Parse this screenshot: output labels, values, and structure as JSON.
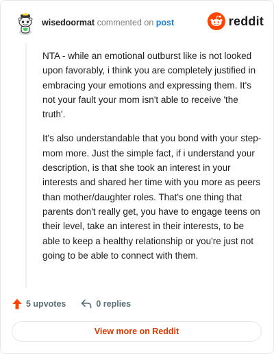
{
  "header": {
    "username": "wisedoormat",
    "action_text": "commented on",
    "link_text": "post",
    "brand": "reddit",
    "avatar_icon": "snoo-avatar-icon",
    "brand_icon": "reddit-logo-icon"
  },
  "comment": {
    "paragraphs": [
      "NTA - while an emotional outburst like is not looked upon favorably, i think you are completely justified in embracing your emotions and expressing them. It's not your fault your mom isn't able to receive 'the truth'.",
      "It's also understandable that you bond with your step-mom more. Just the simple fact, if i understand your description, is that she took an interest in your interests and shared her time with you more as peers than mother/daughter roles. That's one thing that parents don't really get, you have to engage teens on their level, take an interest in their interests, to be able to keep a healthy relationship or you're just not going to be able to connect with them."
    ]
  },
  "actions": {
    "upvotes": "5 upvotes",
    "replies": "0 replies",
    "upvote_icon": "upvote-arrow-icon",
    "reply_icon": "reply-arrow-icon"
  },
  "footer": {
    "view_more": "View more on Reddit"
  },
  "colors": {
    "brand_orange": "#ff4500",
    "link_blue": "#1a7acb",
    "cta_orange": "#d93a00"
  }
}
